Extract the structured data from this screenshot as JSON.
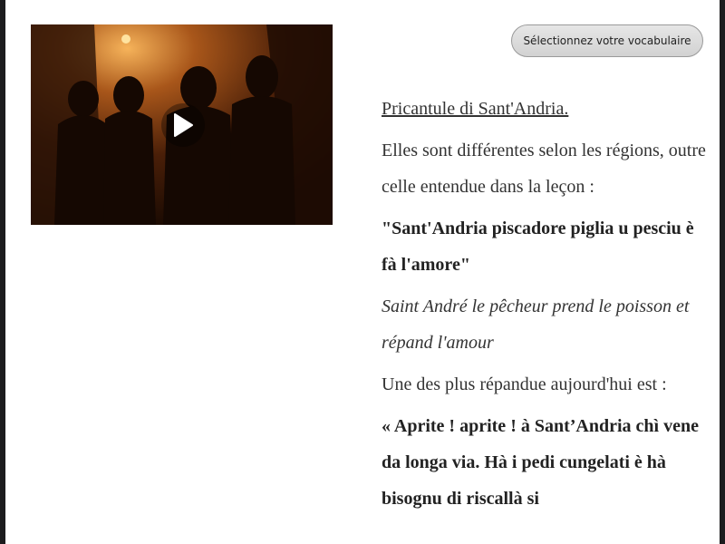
{
  "toolbar": {
    "vocab_button_label": "Sélectionnez votre vocabulaire"
  },
  "video": {
    "icon": "play-icon"
  },
  "content": {
    "title": "Pricantule di Sant'Andria.",
    "intro": "Elles sont différentes selon les régions, outre celle entendue dans la leçon :",
    "quote1_corsican": "\"Sant'Andria piscadore piglia u pesciu è fà l'amore\"",
    "quote1_french": "Saint André le pêcheur prend le poisson et répand l'amour",
    "quote2_intro": "Une des plus répandue aujourd'hui est :",
    "quote2_corsican": "« Aprite ! aprite ! à Sant’Andria chì vene da longa via. Hà i pedi cungelati è hà bisognu di riscallà si"
  }
}
